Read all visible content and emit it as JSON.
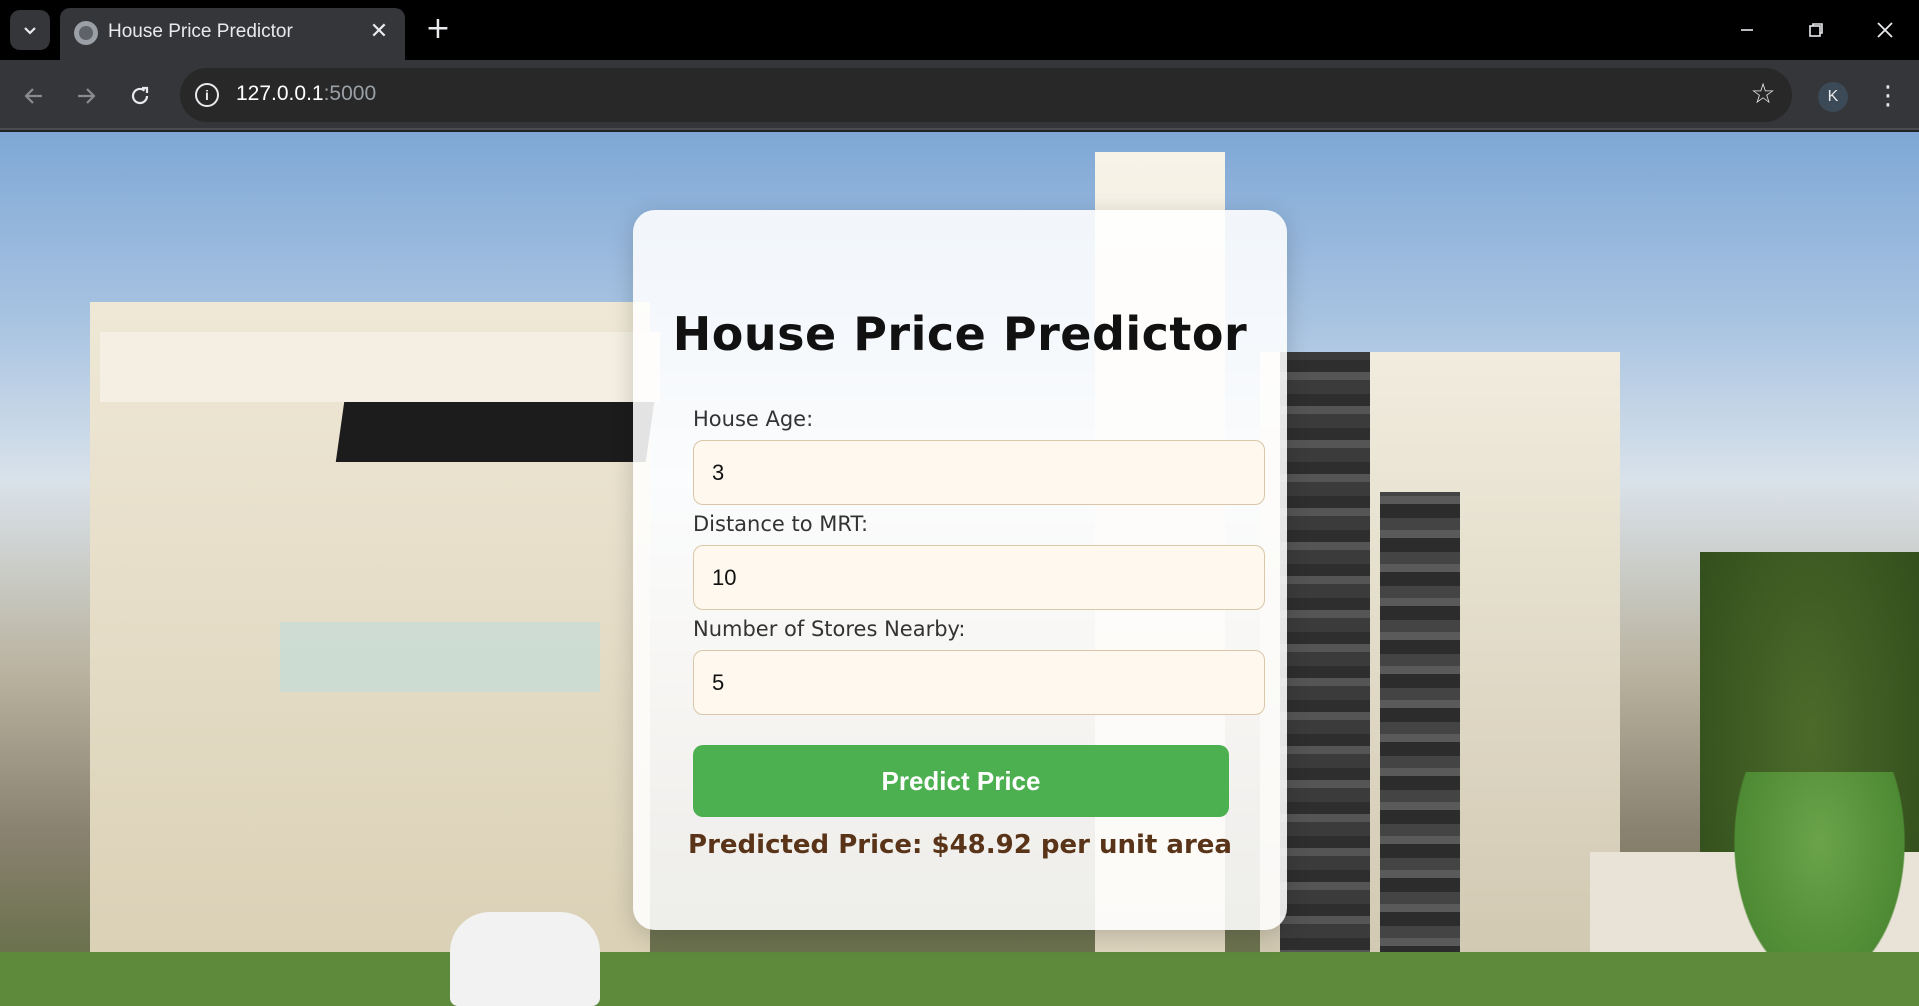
{
  "browser": {
    "tab_title": "House Price Predictor",
    "url_host": "127.0.0.1",
    "url_port": ":5000",
    "profile_initial": "K",
    "icons": {
      "tab_menu": "chevron-down-icon",
      "favicon": "globe-icon",
      "tab_close": "close-icon",
      "new_tab": "plus-icon",
      "minimize": "minimize-icon",
      "restore": "restore-icon",
      "close_window": "close-icon",
      "back": "arrow-left-icon",
      "forward": "arrow-right-icon",
      "reload": "reload-icon",
      "site_info": "info-icon",
      "bookmark": "star-icon",
      "menu": "kebab-menu-icon"
    }
  },
  "form": {
    "title": "House Price Predictor",
    "fields": [
      {
        "label": "House Age:",
        "value": "3"
      },
      {
        "label": "Distance to MRT:",
        "value": "10"
      },
      {
        "label": "Number of Stores Nearby:",
        "value": "5"
      }
    ],
    "submit_label": "Predict Price",
    "result_text": "Predicted Price: $48.92 per unit area",
    "colors": {
      "button": "#4caf50",
      "result_text": "#5a3418",
      "input_background": "#fff8ef"
    }
  }
}
